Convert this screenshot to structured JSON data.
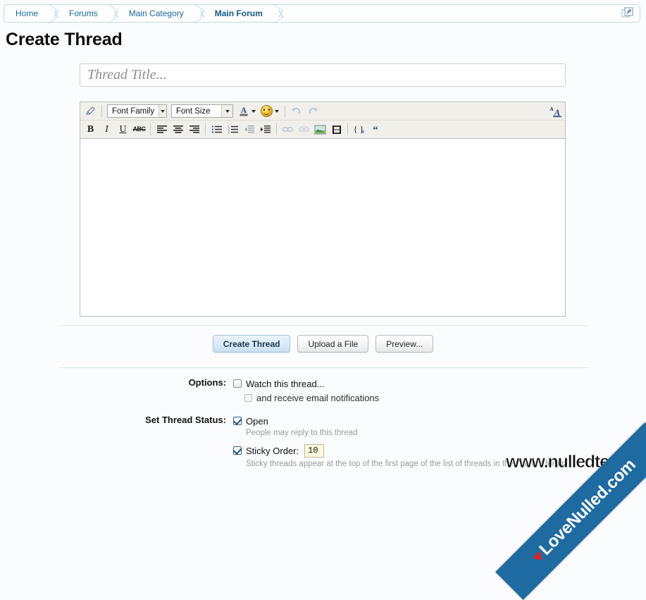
{
  "breadcrumb": {
    "items": [
      {
        "label": "Home",
        "current": false
      },
      {
        "label": "Forums",
        "current": false
      },
      {
        "label": "Main Category",
        "current": false
      },
      {
        "label": "Main Forum",
        "current": true
      }
    ],
    "popup_icon": "open-in-new-window-icon"
  },
  "page": {
    "title": "Create Thread"
  },
  "thread_title": {
    "value": "",
    "placeholder": "Thread Title..."
  },
  "editor": {
    "toolbar_row1": [
      {
        "name": "remove-formatting-icon",
        "label": ""
      },
      {
        "name": "font-family-select",
        "label": "Font Family"
      },
      {
        "name": "font-size-select",
        "label": "Font Size"
      },
      {
        "name": "font-color-icon",
        "label": ""
      },
      {
        "name": "smiley-icon",
        "label": ""
      },
      {
        "name": "undo-icon",
        "label": ""
      },
      {
        "name": "redo-icon",
        "label": ""
      },
      {
        "name": "toggle-bbcode-icon",
        "label": ""
      }
    ],
    "toolbar_row2": [
      {
        "name": "bold-icon",
        "label": "B"
      },
      {
        "name": "italic-icon",
        "label": "I"
      },
      {
        "name": "underline-icon",
        "label": "U"
      },
      {
        "name": "strikethrough-icon",
        "label": "ABC"
      },
      {
        "name": "align-left-icon",
        "label": ""
      },
      {
        "name": "align-center-icon",
        "label": ""
      },
      {
        "name": "align-right-icon",
        "label": ""
      },
      {
        "name": "bullet-list-icon",
        "label": ""
      },
      {
        "name": "numbered-list-icon",
        "label": ""
      },
      {
        "name": "outdent-icon",
        "label": ""
      },
      {
        "name": "indent-icon",
        "label": ""
      },
      {
        "name": "link-icon",
        "label": ""
      },
      {
        "name": "unlink-icon",
        "label": ""
      },
      {
        "name": "insert-image-icon",
        "label": ""
      },
      {
        "name": "insert-media-icon",
        "label": ""
      },
      {
        "name": "code-icon",
        "label": "{}"
      },
      {
        "name": "quote-icon",
        "label": "“"
      }
    ],
    "font_family_label": "Font Family",
    "font_size_label": "Font Size",
    "body_value": ""
  },
  "buttons": {
    "create_thread": "Create Thread",
    "upload_file": "Upload a File",
    "preview": "Preview..."
  },
  "options": {
    "label": "Options:",
    "watch_thread": "Watch this thread...",
    "watch_thread_checked": false,
    "email_notifications": "and receive email notifications",
    "email_notifications_checked": false
  },
  "thread_status": {
    "label": "Set Thread Status:",
    "open_label": "Open",
    "open_checked": true,
    "open_hint": "People may reply to this thread",
    "sticky_label": "Sticky Order:",
    "sticky_checked": true,
    "sticky_value": "10",
    "sticky_hint": "Sticky threads appear at the top of the first page of the list of threads in their parent forum"
  },
  "watermarks": {
    "text": "www.nulledteam.com",
    "ribbon": "LoveNulled.com",
    "heart": "♥"
  },
  "colors": {
    "accent_blue": "#1b6a9c",
    "ribbon_blue": "#1e6ba1",
    "heart_red": "#e02020",
    "sticky_input_bg": "#fbfbdd",
    "divider": "#d7e7f0"
  }
}
